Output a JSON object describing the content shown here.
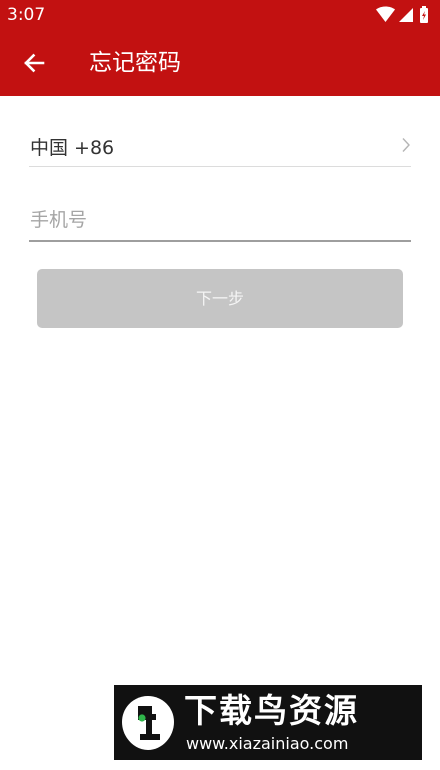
{
  "status_bar": {
    "time": "3:07",
    "icons": [
      "wifi-icon",
      "signal-icon",
      "battery-icon"
    ]
  },
  "toolbar": {
    "back_icon": "arrow-left-icon",
    "title": "忘记密码"
  },
  "form": {
    "country_code_label": "中国 +86",
    "country_chevron_icon": "chevron-right-icon",
    "phone_value": "",
    "phone_placeholder": "手机号",
    "next_label": "下一步"
  },
  "watermark": {
    "title": "下载鸟资源",
    "url": "www.xiazainiao.com"
  },
  "colors": {
    "appbar": "#c21111",
    "button_disabled": "#c5c5c5",
    "placeholder": "#a5a5a5",
    "divider": "#dcdcdc",
    "underline": "#9e9e9e"
  }
}
